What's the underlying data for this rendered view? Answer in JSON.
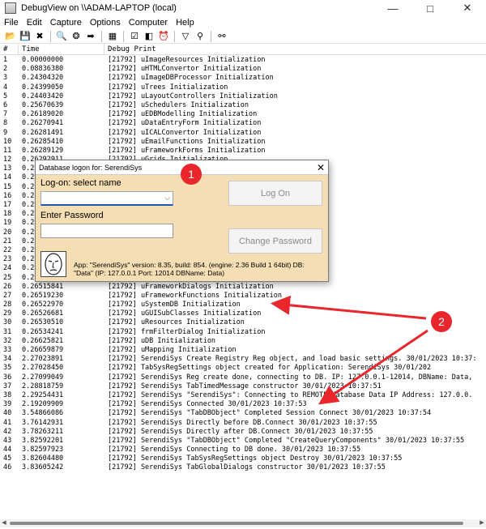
{
  "window": {
    "title": "DebugView on \\\\ADAM-LAPTOP (local)",
    "icon": "debugview-app-icon",
    "controls": [
      "minimize-icon",
      "maximize-icon",
      "close-icon"
    ]
  },
  "menu": [
    "File",
    "Edit",
    "Capture",
    "Options",
    "Computer",
    "Help"
  ],
  "toolbar": {
    "icons": [
      {
        "name": "open-icon",
        "glyph": "📂"
      },
      {
        "name": "save-icon",
        "glyph": "💾"
      },
      {
        "name": "clear-icon",
        "glyph": "✖"
      },
      {
        "name": "find-icon",
        "glyph": "🔍"
      },
      {
        "name": "capture-icon",
        "glyph": "❂"
      },
      {
        "name": "autoscroll-icon",
        "glyph": "➡"
      },
      {
        "name": "clear-display-icon",
        "glyph": "▦"
      },
      {
        "name": "time-format-icon",
        "glyph": "☑"
      },
      {
        "name": "options-icon",
        "glyph": "◧"
      },
      {
        "name": "clock-icon",
        "glyph": "⏰"
      },
      {
        "name": "filter-icon",
        "glyph": "▽"
      },
      {
        "name": "highlight-icon",
        "glyph": "⚲"
      },
      {
        "name": "binoculars-icon",
        "glyph": "⚯"
      }
    ]
  },
  "columns": {
    "num": "#",
    "time": "Time",
    "debug": "Debug Print"
  },
  "rows": [
    [
      "1",
      "0.00000000",
      "[21792] uImageResources Initialization"
    ],
    [
      "2",
      "0.08836380",
      "[21792] uHTMLConvertor Initialization"
    ],
    [
      "3",
      "0.24304320",
      "[21792] uImageDBProcessor Initialization"
    ],
    [
      "4",
      "0.24399050",
      "[21792] uTrees Initialization"
    ],
    [
      "5",
      "0.24403420",
      "[21792] uLayoutControllers Initialization"
    ],
    [
      "6",
      "0.25670639",
      "[21792] uSchedulers Initialization"
    ],
    [
      "7",
      "0.26189020",
      "[21792] uEDBModelling Initialization"
    ],
    [
      "8",
      "0.26270941",
      "[21792] uDataEntryForm Initialization"
    ],
    [
      "9",
      "0.26281491",
      "[21792] uICALConvertor Initialization"
    ],
    [
      "10",
      "0.26285410",
      "[21792] uEmailFunctions Initialization"
    ],
    [
      "11",
      "0.26289129",
      "[21792] uFrameworkForms Initialization"
    ],
    [
      "12",
      "0.26292911",
      "[21792] uGrids Initialization"
    ],
    [
      "13",
      "0.2",
      ""
    ],
    [
      "14",
      "0.2",
      ""
    ],
    [
      "15",
      "0.2",
      ""
    ],
    [
      "16",
      "0.2",
      ""
    ],
    [
      "17",
      "0.2",
      ""
    ],
    [
      "18",
      "0.2",
      ""
    ],
    [
      "19",
      "0.2",
      ""
    ],
    [
      "20",
      "0.2",
      ""
    ],
    [
      "21",
      "0.2",
      ""
    ],
    [
      "22",
      "0.2",
      ""
    ],
    [
      "23",
      "0.2",
      ""
    ],
    [
      "24",
      "0.2",
      ""
    ],
    [
      "25",
      "0.2",
      ""
    ],
    [
      "26",
      "0.26515841",
      "[21792] uFrameworkDialogs Initialization"
    ],
    [
      "27",
      "0.26519230",
      "[21792] uFrameworkFunctions Initialization"
    ],
    [
      "28",
      "0.26522970",
      "[21792] uSystemDB Initialization"
    ],
    [
      "29",
      "0.26526681",
      "[21792] uGUISubClasses Initialization"
    ],
    [
      "30",
      "0.26530510",
      "[21792] uResources Initialization"
    ],
    [
      "31",
      "0.26534241",
      "[21792] frmFilterDialog Initialization"
    ],
    [
      "32",
      "0.26625821",
      "[21792] uDB Initialization"
    ],
    [
      "33",
      "0.26659879",
      "[21792] uMapping Initialization"
    ],
    [
      "34",
      "2.27023891",
      "[21792] SerendiSys Create Registry Reg object, and load basic settings.  30/01/2023 10:37:"
    ],
    [
      "35",
      "2.27028450",
      "[21792] TabSysRegSettings object created for Application: SerendiSys 30/01/202"
    ],
    [
      "36",
      "2.27099049",
      "[21792] SerendiSys Reg create done, connecting to DB. IP: 127.0.0.1-12014, DBName: Data,"
    ],
    [
      "37",
      "2.28818759",
      "[21792] SerendiSys TabTimedMessage constructor 30/01/2023 10:37:51"
    ],
    [
      "38",
      "2.29254431",
      "[21792] SerendiSys \"SerendiSys\": Connecting to REMOTE database Data  IP Address: 127.0.0."
    ],
    [
      "39",
      "2.19209909",
      "[21792] SerendiSys Connected 30/01/2023 10:37:53"
    ],
    [
      "40",
      "3.54866086",
      "[21792] SerendiSys \"TabDBObject\" Completed Session Connect 30/01/2023 10:37:54"
    ],
    [
      "41",
      "3.76142931",
      "[21792] SerendiSys Directly before DB.Connect 30/01/2023 10:37:55"
    ],
    [
      "42",
      "3.78263211",
      "[21792] SerendiSys Directly after DB.Connect 30/01/2023 10:37:55"
    ],
    [
      "43",
      "3.82592201",
      "[21792] SerendiSys \"TabDBObject\" Completed \"CreateQueryComponents\" 30/01/2023 10:37:55"
    ],
    [
      "44",
      "3.82597923",
      "[21792] SerendiSys Connecting to DB done. 30/01/2023 10:37:55"
    ],
    [
      "45",
      "3.82604480",
      "[21792] SerendiSys TabSysRegSettings object Destroy  30/01/2023 10:37:55"
    ],
    [
      "46",
      "3.83605242",
      "[21792] SerendiSys TabGlobalDialogs constructor 30/01/2023 10:37:55"
    ]
  ],
  "dialog": {
    "title": "Database logon for: SerendiSys",
    "logon_label": "Log-on: select name",
    "name_value": "",
    "password_label": "Enter Password",
    "password_value": "",
    "logon_button": "Log On",
    "change_password_button": "Change Password",
    "info_line1": "App: \"SerendiSys\" version: 8.35, build: 854. (engine: 2.36 Build 1 64bit) DB:",
    "info_line2": "\"Data\" (IP: 127.0.0.1 Port: 12014 DBName: Data)"
  },
  "annotations": {
    "marker1": "1",
    "marker2": "2",
    "color": "#e8262c"
  }
}
